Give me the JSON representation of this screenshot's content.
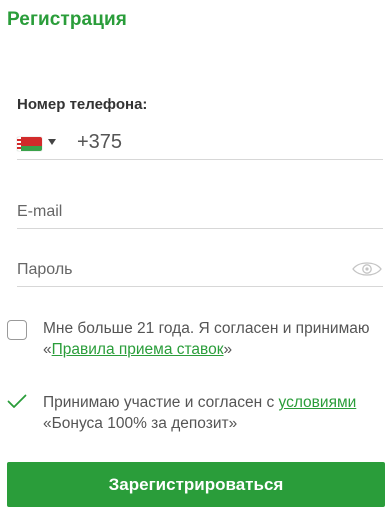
{
  "form": {
    "title": "Регистрация",
    "phone": {
      "label": "Номер телефона:",
      "country_code": "+375",
      "flag_icon": "belarus-flag-icon"
    },
    "email": {
      "placeholder": "E-mail",
      "value": ""
    },
    "password": {
      "placeholder": "Пароль",
      "value": ""
    },
    "age_consent": {
      "checked": false,
      "text_before": "Мне больше 21 года. Я согласен и принимаю «",
      "link": "Правила приема ставок",
      "text_after": "»"
    },
    "bonus_consent": {
      "checked": true,
      "text_before": "Принимаю участие и согласен с ",
      "link": "условиями",
      "text_after": " «Бонуса 100% за депозит»"
    },
    "submit_label": "Зарегистрироваться"
  },
  "colors": {
    "accent": "#2a9d3a",
    "text": "#555555",
    "divider": "#d7d7d7"
  }
}
